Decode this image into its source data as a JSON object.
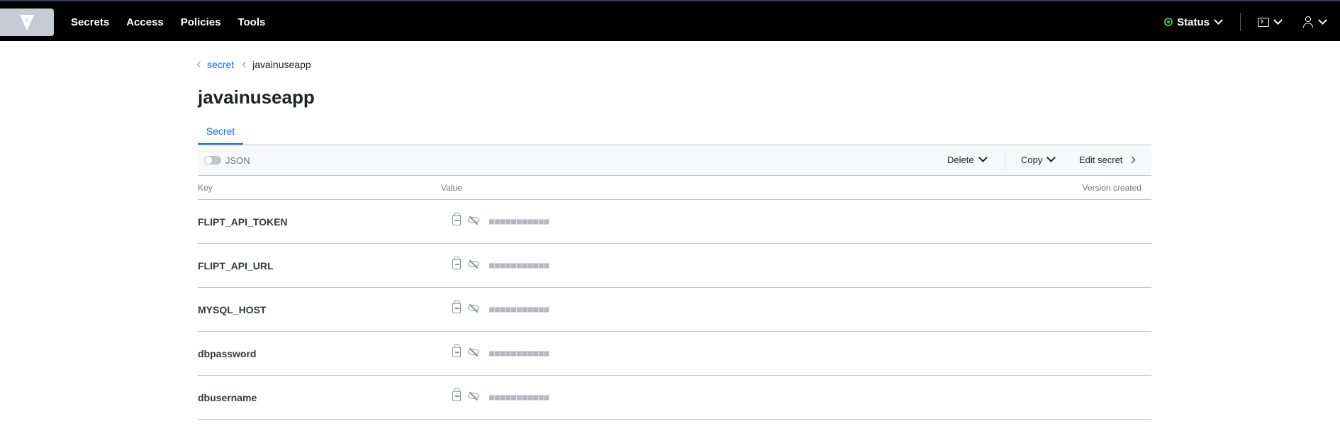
{
  "nav": {
    "items": [
      "Secrets",
      "Access",
      "Policies",
      "Tools"
    ],
    "status_label": "Status"
  },
  "breadcrumb": {
    "parent": "secret",
    "current": "javainuseapp"
  },
  "page": {
    "title": "javainuseapp",
    "tab": "Secret"
  },
  "toolbar": {
    "json_toggle_label": "JSON",
    "json_toggle_on": false,
    "delete_label": "Delete",
    "copy_label": "Copy",
    "edit_label": "Edit secret"
  },
  "table": {
    "headers": {
      "key": "Key",
      "value": "Value",
      "version": "Version created"
    },
    "masked_placeholder": "■■■■■■■■■■■",
    "rows": [
      {
        "key": "FLIPT_API_TOKEN"
      },
      {
        "key": "FLIPT_API_URL"
      },
      {
        "key": "MYSQL_HOST"
      },
      {
        "key": "dbpassword"
      },
      {
        "key": "dbusername"
      }
    ]
  },
  "colors": {
    "topbar": "#000000",
    "accent": "#1563ff",
    "status_ok": "#57b45f"
  }
}
